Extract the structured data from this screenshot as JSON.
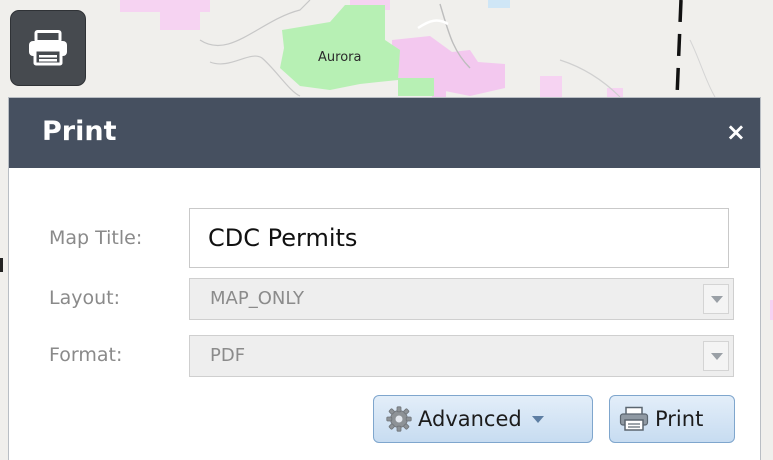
{
  "map": {
    "place_label": "Aurora"
  },
  "toolbar": {
    "print_toggle_icon": "printer-icon"
  },
  "dialog": {
    "title": "Print",
    "close_glyph": "×",
    "fields": {
      "map_title_label": "Map Title:",
      "map_title_value": "CDC Permits",
      "layout_label": "Layout:",
      "layout_value": "MAP_ONLY",
      "format_label": "Format:",
      "format_value": "PDF"
    },
    "buttons": {
      "advanced_label": "Advanced",
      "advanced_icon": "gear-icon",
      "print_label": "Print",
      "print_icon": "printer-icon"
    }
  },
  "colors": {
    "header_bg": "#465060",
    "toggle_bg": "#464a4f",
    "button_gradient_top": "#e3eef9",
    "button_gradient_bottom": "#c7dcf1",
    "button_border": "#7fa6cd",
    "map_green": "#b7f0b4",
    "map_pink": "#f3c8ef"
  }
}
